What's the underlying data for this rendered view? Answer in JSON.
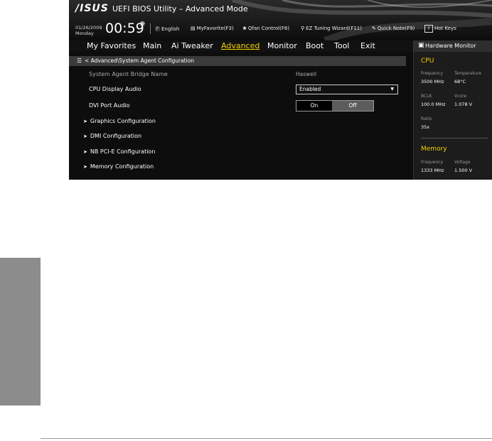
{
  "header": {
    "logo": "/ISUS",
    "title": "UEFI BIOS Utility – Advanced Mode",
    "date": "01/26/2009",
    "day": "Monday",
    "time": "00:59",
    "tools": {
      "language": "English",
      "myfavorite": "MyFavorite(F3)",
      "qfan": "Qfan Control(F6)",
      "ez_tuning": "EZ Tuning Wizard(F11)",
      "quick_note": "Quick Note(F9)",
      "hot_keys": "Hot Keys"
    }
  },
  "menu": {
    "items": [
      {
        "label": "My Favorites"
      },
      {
        "label": "Main"
      },
      {
        "label": "Ai Tweaker"
      },
      {
        "label": "Advanced"
      },
      {
        "label": "Monitor"
      },
      {
        "label": "Boot"
      },
      {
        "label": "Tool"
      },
      {
        "label": "Exit"
      }
    ],
    "active": "Advanced"
  },
  "breadcrumb": {
    "text": "< Advanced\\System Agent Configuration"
  },
  "settings": {
    "bridge_name_label": "System Agent Bridge Name",
    "bridge_name_value": "Haswell",
    "cpu_audio_label": "CPU Display Audio",
    "cpu_audio_value": "Enabled",
    "dvi_audio_label": "DVI Port Audio",
    "dvi_on": "On",
    "dvi_off": "Off",
    "dvi_selected": "On"
  },
  "submenus": [
    {
      "label": "Graphics Configuration"
    },
    {
      "label": "DMI Configuration"
    },
    {
      "label": "NB PCI-E Configuration"
    },
    {
      "label": "Memory Configuration"
    }
  ],
  "hardware_monitor": {
    "title": "Hardware Monitor",
    "cpu": {
      "section": "CPU",
      "frequency_label": "Frequency",
      "frequency_value": "3500 MHz",
      "temperature_label": "Temperature",
      "temperature_value": "68°C",
      "bclk_label": "BCLK",
      "bclk_value": "100.0 MHz",
      "vcore_label": "Vcore",
      "vcore_value": "1.078 V",
      "ratio_label": "Ratio",
      "ratio_value": "35x"
    },
    "memory": {
      "section": "Memory",
      "frequency_label": "Frequency",
      "frequency_value": "1333 MHz",
      "voltage_label": "Voltage",
      "voltage_value": "1.500 V"
    }
  },
  "colors": {
    "accent": "#f5d000",
    "background": "#0d0d0d",
    "breadcrumb": "#3b3b3b",
    "panel": "#1c1c1c"
  }
}
